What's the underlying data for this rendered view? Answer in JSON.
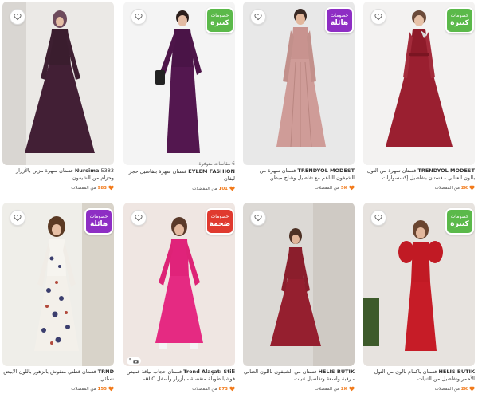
{
  "products": [
    {
      "brand": "TRENDYOL MODEST",
      "title": " فستان سهرة من التول بالون العنابي - فستان بتفاصيل إكسسوارات...",
      "note": "",
      "fav_count": "2K",
      "fav_text": "من المفضلات",
      "badge": {
        "line1": "خصومات",
        "line2": "كبيرة",
        "color": "green"
      }
    },
    {
      "brand": "TRENDYOL MODEST",
      "title": " فستان سهرة من الشيفون الناعم مع تفاصيل وشاح مبطن...",
      "note": "",
      "fav_count": "5K",
      "fav_text": "من المفضلات",
      "badge": {
        "line1": "خصومات",
        "line2": "هائلة",
        "color": "purple"
      }
    },
    {
      "brand": "EYLEM FASHION",
      "title": " فستان سهرة بتفاصيل حجر ليفان",
      "note": "6 مقاسات متوفرة",
      "fav_count": "101",
      "fav_text": "من المفضلات",
      "badge": {
        "line1": "خصومات",
        "line2": "كبيرة",
        "color": "green"
      }
    },
    {
      "brand": "Nursima",
      "title": " 5383 فستان سهرة مزين بالأزرار وحزام من الشيفون",
      "note": "",
      "fav_count": "983",
      "fav_text": "من المفضلات",
      "badge": null
    },
    {
      "brand": "HELİS BUTİK",
      "title": " فستان بأكمام بالون من التول الأحمر وتفاصيل من الثنيات",
      "note": "",
      "fav_count": "2K",
      "fav_text": "من المفضلات",
      "badge": {
        "line1": "خصومات",
        "line2": "كبيرة",
        "color": "green"
      }
    },
    {
      "brand": "HELİS BUTİK",
      "title": " فستان من الشيفون باللون العنابي - رقبة واسعة وتفاصيل ثنيات",
      "note": "",
      "fav_count": "2K",
      "fav_text": "من المفضلات",
      "badge": null
    },
    {
      "brand": "Trend Alaçatı Stili",
      "title": " فستان حجاب بياقة قميص فوشيا طويلة منفصلة - بأزرار وأسفل ALC-...",
      "note": "",
      "fav_count": "873",
      "fav_text": "من المفضلات",
      "badge": {
        "line1": "خصومات",
        "line2": "ضخمة",
        "color": "red"
      },
      "thumb_count": "5"
    },
    {
      "brand": "TRND",
      "title": " فستان قطني منقوش بالزهور باللون الأبيض نسائي",
      "note": "",
      "fav_count": "155",
      "fav_text": "من المفضلات",
      "badge": {
        "line1": "خصومات",
        "line2": "هائلة",
        "color": "purple"
      }
    }
  ],
  "icons": {
    "favorite": "heart-outline-icon",
    "fav_badge": "heart-filled-icon",
    "thumbs": "camera-icon"
  },
  "colors": {
    "accent": "#f27a1a",
    "badge_green": "#5bb94a",
    "badge_purple": "#8e2ec4",
    "badge_red": "#e03a2f"
  }
}
